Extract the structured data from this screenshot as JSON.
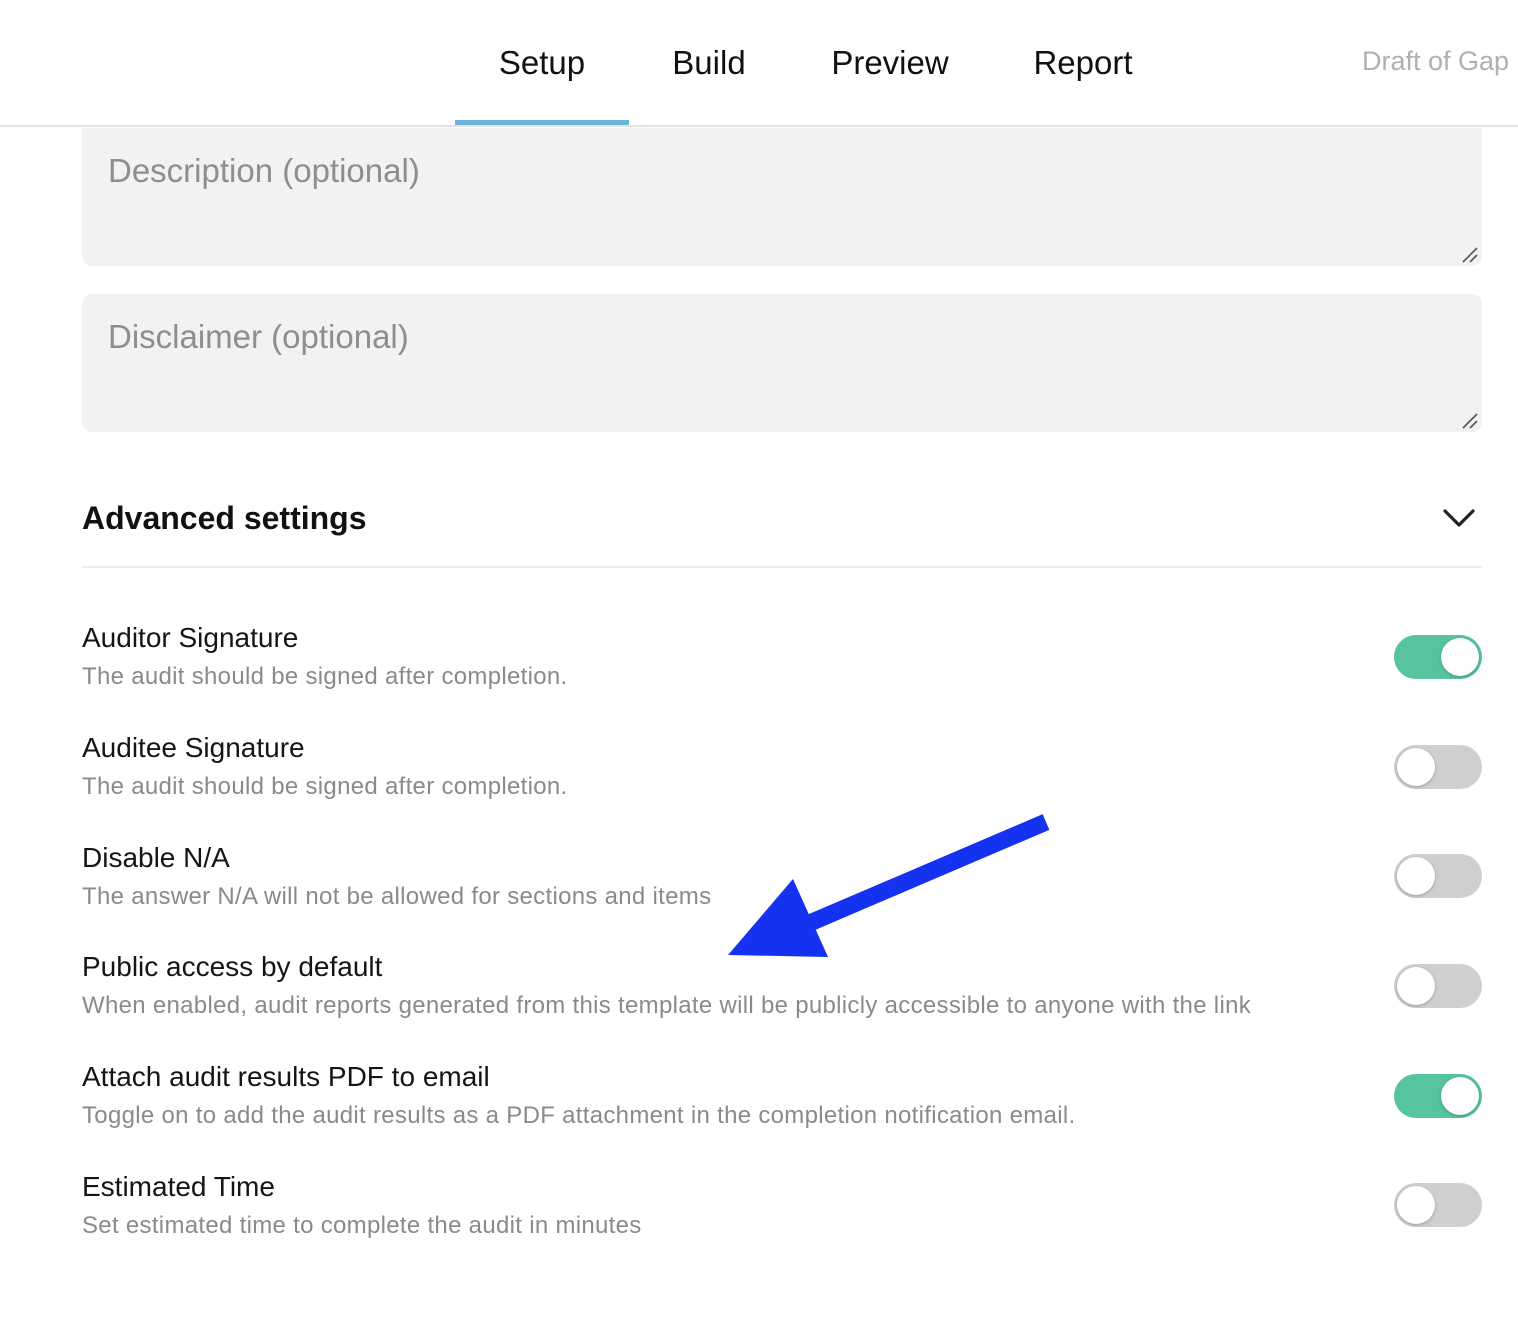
{
  "nav": {
    "tabs": [
      {
        "label": "Setup",
        "active": true
      },
      {
        "label": "Build",
        "active": false
      },
      {
        "label": "Preview",
        "active": false
      },
      {
        "label": "Report",
        "active": false
      }
    ],
    "draft_title": "Draft of Gap"
  },
  "form": {
    "description_placeholder": "Description (optional)",
    "description_value": "",
    "disclaimer_placeholder": "Disclaimer (optional)",
    "disclaimer_value": ""
  },
  "advanced": {
    "title": "Advanced settings",
    "expanded": true,
    "settings": [
      {
        "title": "Auditor Signature",
        "description": "The audit should be signed after completion.",
        "enabled": true
      },
      {
        "title": "Auditee Signature",
        "description": "The audit should be signed after completion.",
        "enabled": false
      },
      {
        "title": "Disable N/A",
        "description": "The answer N/A will not be allowed for sections and items",
        "enabled": false
      },
      {
        "title": "Public access by default",
        "description": "When enabled, audit reports generated from this template will be publicly accessible to anyone with the link",
        "enabled": false
      },
      {
        "title": "Attach audit results PDF to email",
        "description": "Toggle on to add the audit results as a PDF attachment in the completion notification email.",
        "enabled": true
      },
      {
        "title": "Estimated Time",
        "description": "Set estimated time to complete the audit in minutes",
        "enabled": false
      }
    ]
  },
  "colors": {
    "tab_underline": "#6cb4d8",
    "toggle_on": "#56c59e",
    "toggle_off": "#cfcfcf",
    "annotation_arrow": "#1432f0"
  },
  "icons": {
    "chevron": "chevron-down-icon",
    "resize": "resize-grip-icon",
    "annotation": "arrow-annotation"
  }
}
